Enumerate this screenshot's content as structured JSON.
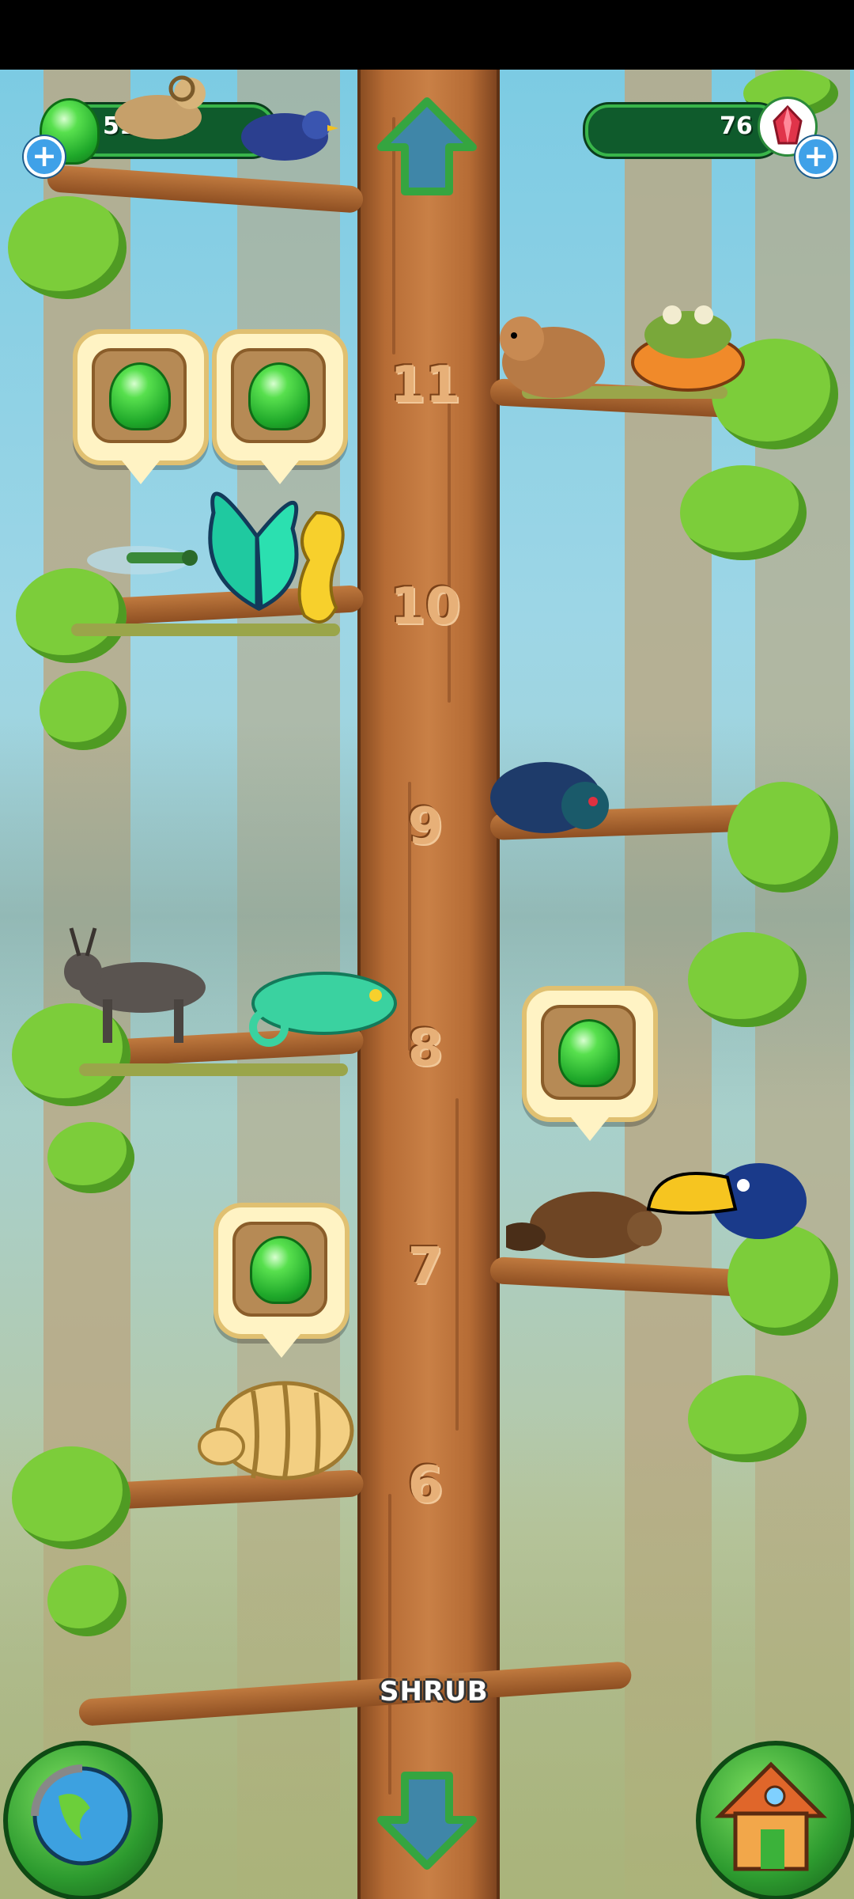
{
  "hud": {
    "green_gems": "51391",
    "red_crystals": "76",
    "add_gems_label": "+",
    "add_crystals_label": "+"
  },
  "tree": {
    "levels": [
      "11",
      "10",
      "9",
      "8",
      "7",
      "6"
    ],
    "zone_label": "SHRUB"
  },
  "animals": [
    "ram",
    "blue-bird",
    "hamster",
    "crab",
    "dragonfly",
    "butterfly",
    "seahorse",
    "spider",
    "antelope",
    "chameleon",
    "beaver",
    "toucan",
    "armadillo"
  ],
  "colors": {
    "trunk": "#b66c35",
    "gem_green": "#2db838",
    "hud_bar": "#0f5b2c",
    "leaf": "#7ccd3a"
  },
  "icons": {
    "up_arrow": "up-arrow-icon",
    "down_arrow": "down-arrow-icon",
    "globe": "globe-icon",
    "house": "house-icon",
    "gem": "green-gem-icon",
    "crystal": "red-crystal-icon"
  }
}
